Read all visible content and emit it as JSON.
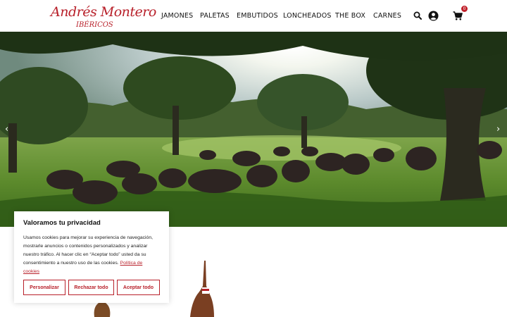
{
  "brand": {
    "logo_name": "Andrés Montero",
    "logo_sub": "IBÉRICOS",
    "color": "#b8202a"
  },
  "nav": {
    "items": [
      {
        "label": "JAMONES"
      },
      {
        "label": "PALETAS"
      },
      {
        "label": "EMBUTIDOS"
      },
      {
        "label": "LONCHEADOS"
      },
      {
        "label": "THE BOX"
      },
      {
        "label": "CARNES"
      }
    ]
  },
  "header_icons": {
    "search": "search-icon",
    "account": "user-circle-icon",
    "cart": "cart-icon",
    "cart_count": "0"
  },
  "hero": {
    "prev_arrow": "‹",
    "next_arrow": "›"
  },
  "cookie": {
    "title": "Valoramos tu privacidad",
    "text": "Usamos cookies para mejorar su experiencia de navegación, mostrarle anuncios o contenidos personalizados y analizar nuestro tráfico. Al hacer clic en “Aceptar todo” usted da su consentimiento a nuestro uso de las cookies.",
    "policy_link": "Política de cookies",
    "btn_customize": "Personalizar",
    "btn_reject": "Rechazar todo",
    "btn_accept": "Aceptar todo"
  }
}
